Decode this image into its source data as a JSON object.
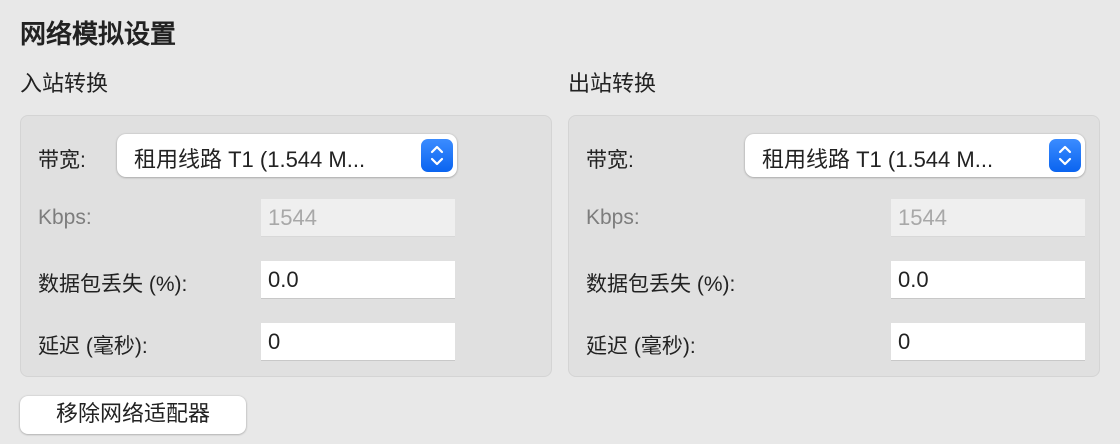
{
  "title": "网络模拟设置",
  "inbound": {
    "heading": "入站转换",
    "bandwidth_label": "带宽:",
    "bandwidth_value": "租用线路 T1 (1.544 M...",
    "kbps_label": "Kbps:",
    "kbps_value": "1544",
    "packet_loss_label": "数据包丢失 (%):",
    "packet_loss_value": "0.0",
    "delay_label": "延迟 (毫秒):",
    "delay_value": "0"
  },
  "outbound": {
    "heading": "出站转换",
    "bandwidth_label": "带宽:",
    "bandwidth_value": "租用线路 T1 (1.544 M...",
    "kbps_label": "Kbps:",
    "kbps_value": "1544",
    "packet_loss_label": "数据包丢失 (%):",
    "packet_loss_value": "0.0",
    "delay_label": "延迟 (毫秒):",
    "delay_value": "0"
  },
  "remove_button": "移除网络适配器",
  "colors": {
    "accent": "#0a64f0",
    "background": "#e8e8e8",
    "panel": "#e0e0e0"
  }
}
